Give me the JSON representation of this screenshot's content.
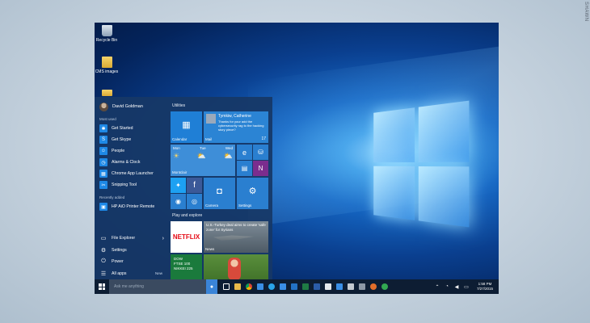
{
  "watermark": "SHAWN",
  "desktop": {
    "icons": [
      {
        "label": "Recycle Bin"
      },
      {
        "label": "CMS images"
      },
      {
        "label": ""
      }
    ]
  },
  "start_menu": {
    "user_name": "David Goldman",
    "most_used_label": "Most used",
    "most_used": [
      {
        "label": "Get Started",
        "icon": "lightbulb-icon",
        "color": "#1e88e5"
      },
      {
        "label": "Get Skype",
        "icon": "skype-icon",
        "color": "#1e88e5"
      },
      {
        "label": "People",
        "icon": "people-icon",
        "color": "#1e88e5"
      },
      {
        "label": "Alarms & Clock",
        "icon": "alarm-icon",
        "color": "#1e88e5"
      },
      {
        "label": "Chrome App Launcher",
        "icon": "grid-icon",
        "color": "#1e88e5"
      },
      {
        "label": "Snipping Tool",
        "icon": "scissors-icon",
        "color": "#1e88e5"
      }
    ],
    "recently_added_label": "Recently added",
    "recently_added": [
      {
        "label": "HP AiO Printer Remote",
        "icon": "printer-icon",
        "color": "#1e88e5"
      }
    ],
    "bottom": [
      {
        "label": "File Explorer",
        "icon": "folder-icon",
        "glyph": "▭",
        "chevron": "›"
      },
      {
        "label": "Settings",
        "icon": "gear-icon",
        "glyph": "⚙"
      },
      {
        "label": "Power",
        "icon": "power-icon",
        "glyph": "⏻"
      },
      {
        "label": "All apps",
        "icon": "list-icon",
        "glyph": "☰",
        "badge": "New"
      }
    ],
    "groups": {
      "utilities": "Utilities",
      "play": "Play and explore"
    },
    "tiles": {
      "calendar": "Calendar",
      "mail": "Mail",
      "mail_sender": "Tymkiw, Catherine",
      "mail_preview": "Thanks for your add the cybersecurity rag to the hacking story piece?",
      "mail_count": "17",
      "weather_days": [
        "Mon",
        "Tue",
        "Wed"
      ],
      "weather_city": "Montclair",
      "camera": "Camera",
      "settings": "Settings",
      "netflix": "NETFLIX",
      "news_headline": "U.S.-Turkey deal aims to create 'safe zone' for Syrians",
      "news": "News",
      "money_lines": [
        "DOW",
        "FTSE 100",
        "NIKKEI 225"
      ]
    }
  },
  "taskbar": {
    "search_placeholder": "Ask me anything",
    "time": "1:58 PM",
    "date": "7/27/2015"
  }
}
